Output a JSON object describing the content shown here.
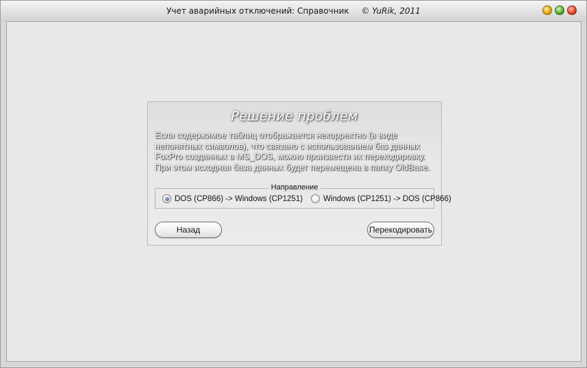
{
  "window": {
    "title": "Учет аварийных отключений: Справочник",
    "copyright": "© YuRik, 2011",
    "controls": [
      "minimize-button",
      "maximize-button",
      "close-button"
    ]
  },
  "panel": {
    "title": "Решение проблем",
    "description": "Если содержимое таблиц отображается некорректно (в виде непонятных символов), что связано с использованием баз данных FoxPro созданных в MS_DOS, можно произвести их перекодировку. При этом исходная база данных будет перемещена в папку OldBase.",
    "direction": {
      "legend": "Направление",
      "options": [
        {
          "label": "DOS (CP866) -> Windows (CP1251)",
          "selected": true
        },
        {
          "label": "Windows (CP1251) -> DOS (CP866)",
          "selected": false
        }
      ]
    },
    "buttons": {
      "back": "Назад",
      "recode": "Перекодировать"
    }
  }
}
